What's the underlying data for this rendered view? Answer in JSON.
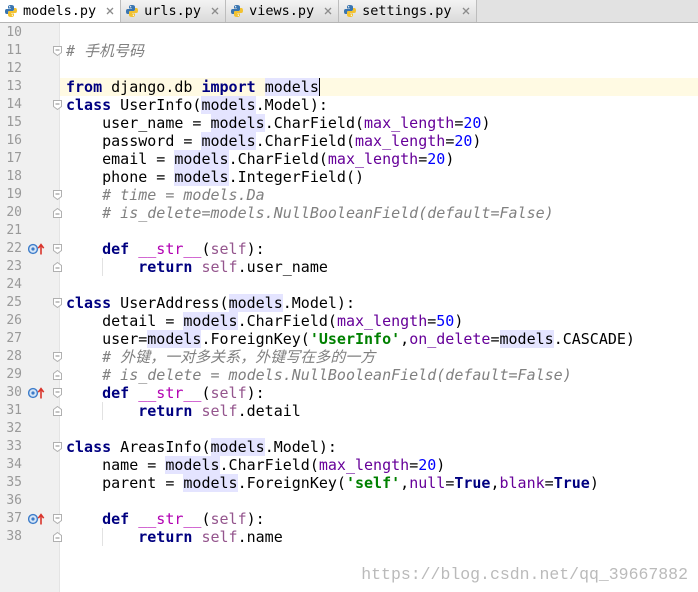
{
  "tabs": [
    {
      "label": "models.py",
      "active": true
    },
    {
      "label": "urls.py",
      "active": false
    },
    {
      "label": "views.py",
      "active": false
    },
    {
      "label": "settings.py",
      "active": false
    }
  ],
  "icons": {
    "file": "python-file-icon",
    "close": "close-icon",
    "override": "override-method-icon",
    "fold_start": "fold-start-icon",
    "fold_end": "fold-end-icon"
  },
  "colors": {
    "keyword": "#000080",
    "self": "#94558D",
    "kwarg": "#660099",
    "number": "#0000FF",
    "string": "#008000",
    "comment": "#808080",
    "magic": "#B200B2",
    "usage_bg": "#E4E4FF",
    "current_line_bg": "#FFFAE3",
    "line_number": "#999999",
    "gutter_bg": "#F0F0F0"
  },
  "editor": {
    "lines": [
      {
        "n": "10",
        "tokens": []
      },
      {
        "n": "11",
        "fold": "start",
        "tokens": [
          {
            "t": "comment",
            "v": "# 手机号码"
          }
        ]
      },
      {
        "n": "12",
        "tokens": []
      },
      {
        "n": "13",
        "current": true,
        "caret": true,
        "tokens": [
          {
            "t": "keyword",
            "v": "from"
          },
          {
            "t": "plain",
            "v": " django.db "
          },
          {
            "t": "keyword",
            "v": "import"
          },
          {
            "t": "plain",
            "v": " "
          },
          {
            "t": "usage",
            "v": "models"
          }
        ]
      },
      {
        "n": "14",
        "fold": "start",
        "tokens": [
          {
            "t": "keyword",
            "v": "class"
          },
          {
            "t": "plain",
            "v": " UserInfo("
          },
          {
            "t": "usage",
            "v": "models"
          },
          {
            "t": "plain",
            "v": ".Model):"
          }
        ]
      },
      {
        "n": "15",
        "tokens": [
          {
            "t": "plain",
            "v": "    user_name = "
          },
          {
            "t": "usage",
            "v": "models"
          },
          {
            "t": "plain",
            "v": ".CharField("
          },
          {
            "t": "kwarg",
            "v": "max_length"
          },
          {
            "t": "plain",
            "v": "="
          },
          {
            "t": "number",
            "v": "20"
          },
          {
            "t": "plain",
            "v": ")"
          }
        ]
      },
      {
        "n": "16",
        "tokens": [
          {
            "t": "plain",
            "v": "    password = "
          },
          {
            "t": "usage",
            "v": "models"
          },
          {
            "t": "plain",
            "v": ".CharField("
          },
          {
            "t": "kwarg",
            "v": "max_length"
          },
          {
            "t": "plain",
            "v": "="
          },
          {
            "t": "number",
            "v": "20"
          },
          {
            "t": "plain",
            "v": ")"
          }
        ]
      },
      {
        "n": "17",
        "tokens": [
          {
            "t": "plain",
            "v": "    email = "
          },
          {
            "t": "usage",
            "v": "models"
          },
          {
            "t": "plain",
            "v": ".CharField("
          },
          {
            "t": "kwarg",
            "v": "max_length"
          },
          {
            "t": "plain",
            "v": "="
          },
          {
            "t": "number",
            "v": "20"
          },
          {
            "t": "plain",
            "v": ")"
          }
        ]
      },
      {
        "n": "18",
        "tokens": [
          {
            "t": "plain",
            "v": "    phone = "
          },
          {
            "t": "usage",
            "v": "models"
          },
          {
            "t": "plain",
            "v": ".IntegerField()"
          }
        ]
      },
      {
        "n": "19",
        "fold": "start",
        "tokens": [
          {
            "t": "plain",
            "v": "    "
          },
          {
            "t": "comment",
            "v": "# time = models.Da"
          }
        ]
      },
      {
        "n": "20",
        "fold": "end",
        "tokens": [
          {
            "t": "plain",
            "v": "    "
          },
          {
            "t": "comment",
            "v": "# is_delete=models.NullBooleanField(default=False)"
          }
        ]
      },
      {
        "n": "21",
        "tokens": []
      },
      {
        "n": "22",
        "override": true,
        "fold": "start",
        "tokens": [
          {
            "t": "plain",
            "v": "    "
          },
          {
            "t": "keyword",
            "v": "def"
          },
          {
            "t": "plain",
            "v": " "
          },
          {
            "t": "magic",
            "v": "__str__"
          },
          {
            "t": "plain",
            "v": "("
          },
          {
            "t": "self",
            "v": "self"
          },
          {
            "t": "plain",
            "v": "):"
          }
        ]
      },
      {
        "n": "23",
        "fold": "end",
        "tokens": [
          {
            "t": "plain",
            "v": "        "
          },
          {
            "t": "keyword",
            "v": "return"
          },
          {
            "t": "plain",
            "v": " "
          },
          {
            "t": "self",
            "v": "self"
          },
          {
            "t": "plain",
            "v": ".user_name"
          }
        ]
      },
      {
        "n": "24",
        "tokens": []
      },
      {
        "n": "25",
        "fold": "start",
        "tokens": [
          {
            "t": "keyword",
            "v": "class"
          },
          {
            "t": "plain",
            "v": " UserAddress("
          },
          {
            "t": "usage",
            "v": "models"
          },
          {
            "t": "plain",
            "v": ".Model):"
          }
        ]
      },
      {
        "n": "26",
        "tokens": [
          {
            "t": "plain",
            "v": "    detail = "
          },
          {
            "t": "usage",
            "v": "models"
          },
          {
            "t": "plain",
            "v": ".CharField("
          },
          {
            "t": "kwarg",
            "v": "max_length"
          },
          {
            "t": "plain",
            "v": "="
          },
          {
            "t": "number",
            "v": "50"
          },
          {
            "t": "plain",
            "v": ")"
          }
        ]
      },
      {
        "n": "27",
        "tokens": [
          {
            "t": "plain",
            "v": "    user="
          },
          {
            "t": "usage",
            "v": "models"
          },
          {
            "t": "plain",
            "v": ".ForeignKey("
          },
          {
            "t": "string",
            "v": "'UserInfo'"
          },
          {
            "t": "plain",
            "v": ","
          },
          {
            "t": "kwarg",
            "v": "on_delete"
          },
          {
            "t": "plain",
            "v": "="
          },
          {
            "t": "usage",
            "v": "models"
          },
          {
            "t": "plain",
            "v": ".CASCADE)"
          }
        ]
      },
      {
        "n": "28",
        "fold": "start",
        "tokens": [
          {
            "t": "plain",
            "v": "    "
          },
          {
            "t": "comment",
            "v": "# 外键，一对多关系，外键写在多的一方"
          }
        ]
      },
      {
        "n": "29",
        "fold": "end",
        "tokens": [
          {
            "t": "plain",
            "v": "    "
          },
          {
            "t": "comment",
            "v": "# is_delete = models.NullBooleanField(default=False)"
          }
        ]
      },
      {
        "n": "30",
        "override": true,
        "fold": "start",
        "tokens": [
          {
            "t": "plain",
            "v": "    "
          },
          {
            "t": "keyword",
            "v": "def"
          },
          {
            "t": "plain",
            "v": " "
          },
          {
            "t": "magic",
            "v": "__str__"
          },
          {
            "t": "plain",
            "v": "("
          },
          {
            "t": "self",
            "v": "self"
          },
          {
            "t": "plain",
            "v": "):"
          }
        ]
      },
      {
        "n": "31",
        "fold": "end",
        "tokens": [
          {
            "t": "plain",
            "v": "        "
          },
          {
            "t": "keyword",
            "v": "return"
          },
          {
            "t": "plain",
            "v": " "
          },
          {
            "t": "self",
            "v": "self"
          },
          {
            "t": "plain",
            "v": ".detail"
          }
        ]
      },
      {
        "n": "32",
        "tokens": []
      },
      {
        "n": "33",
        "fold": "start",
        "tokens": [
          {
            "t": "keyword",
            "v": "class"
          },
          {
            "t": "plain",
            "v": " AreasInfo("
          },
          {
            "t": "usage",
            "v": "models"
          },
          {
            "t": "plain",
            "v": ".Model):"
          }
        ]
      },
      {
        "n": "34",
        "tokens": [
          {
            "t": "plain",
            "v": "    name = "
          },
          {
            "t": "usage",
            "v": "models"
          },
          {
            "t": "plain",
            "v": ".CharField("
          },
          {
            "t": "kwarg",
            "v": "max_length"
          },
          {
            "t": "plain",
            "v": "="
          },
          {
            "t": "number",
            "v": "20"
          },
          {
            "t": "plain",
            "v": ")"
          }
        ]
      },
      {
        "n": "35",
        "tokens": [
          {
            "t": "plain",
            "v": "    parent = "
          },
          {
            "t": "usage",
            "v": "models"
          },
          {
            "t": "plain",
            "v": ".ForeignKey("
          },
          {
            "t": "string",
            "v": "'self'"
          },
          {
            "t": "plain",
            "v": ","
          },
          {
            "t": "kwarg",
            "v": "null"
          },
          {
            "t": "plain",
            "v": "="
          },
          {
            "t": "keyword",
            "v": "True"
          },
          {
            "t": "plain",
            "v": ","
          },
          {
            "t": "kwarg",
            "v": "blank"
          },
          {
            "t": "plain",
            "v": "="
          },
          {
            "t": "keyword",
            "v": "True"
          },
          {
            "t": "plain",
            "v": ")"
          }
        ]
      },
      {
        "n": "36",
        "tokens": []
      },
      {
        "n": "37",
        "override": true,
        "fold": "start",
        "tokens": [
          {
            "t": "plain",
            "v": "    "
          },
          {
            "t": "keyword",
            "v": "def"
          },
          {
            "t": "plain",
            "v": " "
          },
          {
            "t": "magic",
            "v": "__str__"
          },
          {
            "t": "plain",
            "v": "("
          },
          {
            "t": "self",
            "v": "self"
          },
          {
            "t": "plain",
            "v": "):"
          }
        ]
      },
      {
        "n": "38",
        "fold": "end",
        "tokens": [
          {
            "t": "plain",
            "v": "        "
          },
          {
            "t": "keyword",
            "v": "return"
          },
          {
            "t": "plain",
            "v": " "
          },
          {
            "t": "self",
            "v": "self"
          },
          {
            "t": "plain",
            "v": ".name"
          }
        ]
      }
    ]
  },
  "watermark": "https://blog.csdn.net/qq_39667882"
}
